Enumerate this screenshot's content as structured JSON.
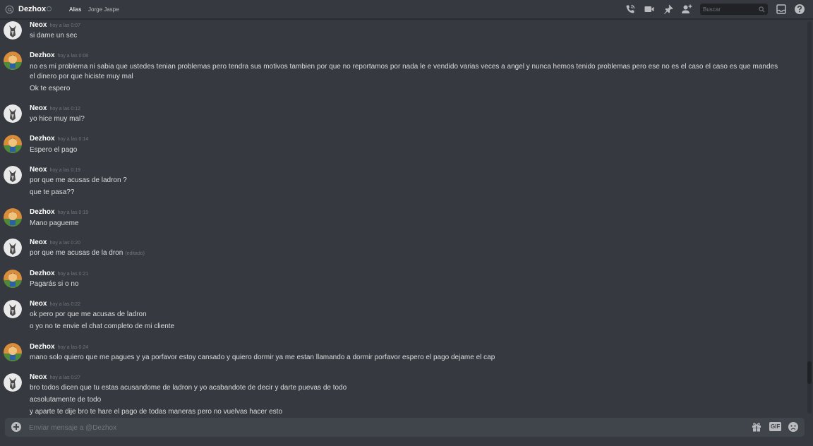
{
  "header": {
    "channel_name": "Dezhox",
    "alias_label": "Alias",
    "alias_value": "Jorge Jaspe",
    "search_placeholder": "Buscar",
    "icons": [
      "call-icon",
      "video-icon",
      "pin-icon",
      "add-friend-icon",
      "search-icon",
      "inbox-icon",
      "help-icon"
    ]
  },
  "colors": {
    "background": "#36393f",
    "composer_bg": "#40444b",
    "username": "#ffffff",
    "text": "#dcddde",
    "muted": "#72767d"
  },
  "messages": [
    {
      "author": "Neox",
      "timestamp": "hoy a las 0:07",
      "lines": [
        "si dame un sec"
      ]
    },
    {
      "author": "Dezhox",
      "timestamp": "hoy a las 0:08",
      "lines": [
        "no es mi problema ni sabia que ustedes tenian problemas pero tendra sus motivos tambien por que no reportamos por nada le e vendido varias veces a angel y nunca hemos tenido problemas pero ese no es el caso el caso es que mandes el dinero por que hiciste muy mal",
        "Ok te espero"
      ]
    },
    {
      "author": "Neox",
      "timestamp": "hoy a las 0:12",
      "lines": [
        "yo hice muy mal?"
      ]
    },
    {
      "author": "Dezhox",
      "timestamp": "hoy a las 0:14",
      "lines": [
        "Espero el pago"
      ]
    },
    {
      "author": "Neox",
      "timestamp": "hoy a las 0:19",
      "lines": [
        "por que me acusas de ladron ?",
        "que te pasa??"
      ]
    },
    {
      "author": "Dezhox",
      "timestamp": "hoy a las 0:19",
      "lines": [
        "Mano pagueme"
      ]
    },
    {
      "author": "Neox",
      "timestamp": "hoy a las 0:20",
      "lines": [
        "por que me acusas de la dron"
      ],
      "edited": "(editado)"
    },
    {
      "author": "Dezhox",
      "timestamp": "hoy a las 0:21",
      "lines": [
        "Pagarás si o no"
      ]
    },
    {
      "author": "Neox",
      "timestamp": "hoy a las 0:22",
      "lines": [
        "ok pero por que me acusas de ladron",
        "o yo no te envie el chat completo de mi cliente"
      ]
    },
    {
      "author": "Dezhox",
      "timestamp": "hoy a las 0:24",
      "lines": [
        "mano solo quiero que me pagues y ya porfavor estoy cansado y quiero dormir ya me estan llamando a dormir porfavor espero el pago dejame el cap"
      ]
    },
    {
      "author": "Neox",
      "timestamp": "hoy a las 0:27",
      "lines": [
        "bro todos dicen que tu estas acusandome de ladron y yo acabandote de decir y darte puevas de todo",
        "acsolutamente de todo",
        "y aparte te dije bro te hare el pago de todas maneras pero no vuelvas hacer esto"
      ]
    }
  ],
  "composer": {
    "placeholder": "Enviar mensaje a @Dezhox",
    "gif_label": "GIF",
    "icons": [
      "upload-plus-icon",
      "gift-icon",
      "gif-icon",
      "emoji-icon"
    ]
  }
}
